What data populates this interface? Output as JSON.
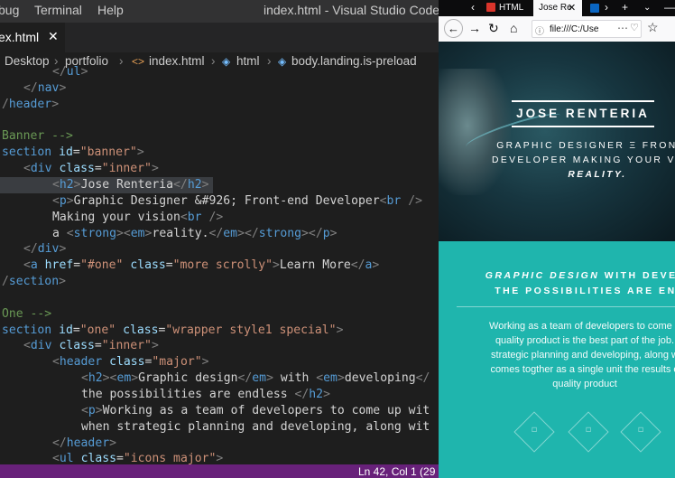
{
  "vscode": {
    "menu": {
      "debug": "bug",
      "terminal": "Terminal",
      "help": "Help",
      "window_title": "index.html - Visual Studio Code"
    },
    "tab": {
      "label": "ex.html",
      "close": "✕"
    },
    "breadcrumb": {
      "items": [
        "Desktop",
        "portfolio",
        "index.html",
        "html",
        "body.landing.is-preload"
      ],
      "separator": "›",
      "icons": [
        "xml-icon",
        "cube-icon",
        "cube-icon"
      ]
    },
    "code_lines": [
      [
        [
          "p",
          "</"
        ],
        [
          "t",
          "ul"
        ],
        [
          "p",
          ">"
        ]
      ],
      [
        [
          "p",
          "</"
        ],
        [
          "t",
          "nav"
        ],
        [
          "p",
          ">"
        ]
      ],
      [
        [
          "p",
          "/"
        ],
        [
          "t",
          "header"
        ],
        [
          "p",
          ">"
        ]
      ],
      [],
      [
        [
          "c",
          "Banner -->"
        ]
      ],
      [
        [
          "t",
          "section"
        ],
        [
          "x",
          " "
        ],
        [
          "a",
          "id"
        ],
        [
          "x",
          "="
        ],
        [
          "s",
          "\"banner\""
        ],
        [
          "p",
          ">"
        ]
      ],
      [
        [
          "p",
          "<"
        ],
        [
          "t",
          "div"
        ],
        [
          "x",
          " "
        ],
        [
          "a",
          "class"
        ],
        [
          "x",
          "="
        ],
        [
          "s",
          "\"inner\""
        ],
        [
          "p",
          ">"
        ]
      ],
      [
        [
          "p",
          "<"
        ],
        [
          "t",
          "h2"
        ],
        [
          "p",
          ">"
        ],
        [
          "x",
          "Jose Renteria"
        ],
        [
          "p",
          "</"
        ],
        [
          "t",
          "h2"
        ],
        [
          "p",
          ">"
        ]
      ],
      [
        [
          "p",
          "<"
        ],
        [
          "t",
          "p"
        ],
        [
          "p",
          ">"
        ],
        [
          "x",
          "Graphic Designer &#926; Front-end Developer"
        ],
        [
          "p",
          "<"
        ],
        [
          "t",
          "br"
        ],
        [
          "x",
          " "
        ],
        [
          "p",
          "/>"
        ]
      ],
      [
        [
          "x",
          "Making your vision"
        ],
        [
          "p",
          "<"
        ],
        [
          "t",
          "br"
        ],
        [
          "x",
          " "
        ],
        [
          "p",
          "/>"
        ]
      ],
      [
        [
          "x",
          "a "
        ],
        [
          "p",
          "<"
        ],
        [
          "t",
          "strong"
        ],
        [
          "p",
          "><"
        ],
        [
          "t",
          "em"
        ],
        [
          "p",
          ">"
        ],
        [
          "x",
          "reality."
        ],
        [
          "p",
          "</"
        ],
        [
          "t",
          "em"
        ],
        [
          "p",
          "></"
        ],
        [
          "t",
          "strong"
        ],
        [
          "p",
          "></"
        ],
        [
          "t",
          "p"
        ],
        [
          "p",
          ">"
        ]
      ],
      [
        [
          "p",
          "</"
        ],
        [
          "t",
          "div"
        ],
        [
          "p",
          ">"
        ]
      ],
      [
        [
          "p",
          "<"
        ],
        [
          "t",
          "a"
        ],
        [
          "x",
          " "
        ],
        [
          "a",
          "href"
        ],
        [
          "x",
          "="
        ],
        [
          "s",
          "\"#one\""
        ],
        [
          "x",
          " "
        ],
        [
          "a",
          "class"
        ],
        [
          "x",
          "="
        ],
        [
          "s",
          "\"more scrolly\""
        ],
        [
          "p",
          ">"
        ],
        [
          "x",
          "Learn More"
        ],
        [
          "p",
          "</"
        ],
        [
          "t",
          "a"
        ],
        [
          "p",
          ">"
        ]
      ],
      [
        [
          "p",
          "/"
        ],
        [
          "t",
          "section"
        ],
        [
          "p",
          ">"
        ]
      ],
      [],
      [
        [
          "c",
          "One -->"
        ]
      ],
      [
        [
          "t",
          "section"
        ],
        [
          "x",
          " "
        ],
        [
          "a",
          "id"
        ],
        [
          "x",
          "="
        ],
        [
          "s",
          "\"one\""
        ],
        [
          "x",
          " "
        ],
        [
          "a",
          "class"
        ],
        [
          "x",
          "="
        ],
        [
          "s",
          "\"wrapper style1 special\""
        ],
        [
          "p",
          ">"
        ]
      ],
      [
        [
          "p",
          "<"
        ],
        [
          "t",
          "div"
        ],
        [
          "x",
          " "
        ],
        [
          "a",
          "class"
        ],
        [
          "x",
          "="
        ],
        [
          "s",
          "\"inner\""
        ],
        [
          "p",
          ">"
        ]
      ],
      [
        [
          "p",
          "<"
        ],
        [
          "t",
          "header"
        ],
        [
          "x",
          " "
        ],
        [
          "a",
          "class"
        ],
        [
          "x",
          "="
        ],
        [
          "s",
          "\"major\""
        ],
        [
          "p",
          ">"
        ]
      ],
      [
        [
          "p",
          "<"
        ],
        [
          "t",
          "h2"
        ],
        [
          "p",
          "><"
        ],
        [
          "t",
          "em"
        ],
        [
          "p",
          ">"
        ],
        [
          "x",
          "Graphic design"
        ],
        [
          "p",
          "</"
        ],
        [
          "t",
          "em"
        ],
        [
          "p",
          ">"
        ],
        [
          "x",
          " with "
        ],
        [
          "p",
          "<"
        ],
        [
          "t",
          "em"
        ],
        [
          "p",
          ">"
        ],
        [
          "x",
          "developing"
        ],
        [
          "p",
          "</"
        ]
      ],
      [
        [
          "x",
          "the possibilities are endless "
        ],
        [
          "p",
          "</"
        ],
        [
          "t",
          "h2"
        ],
        [
          "p",
          ">"
        ]
      ],
      [
        [
          "p",
          "<"
        ],
        [
          "t",
          "p"
        ],
        [
          "p",
          ">"
        ],
        [
          "x",
          "Working as a team of developers to come up wit"
        ]
      ],
      [
        [
          "x",
          "when strategic planning and developing, along wit"
        ]
      ],
      [
        [
          "p",
          "</"
        ],
        [
          "t",
          "header"
        ],
        [
          "p",
          ">"
        ]
      ],
      [
        [
          "p",
          "<"
        ],
        [
          "t",
          "ul"
        ],
        [
          "x",
          " "
        ],
        [
          "a",
          "class"
        ],
        [
          "x",
          "="
        ],
        [
          "s",
          "\"icons major\""
        ],
        [
          "p",
          ">"
        ]
      ]
    ],
    "status": {
      "position": "Ln 42, Col 1 (29"
    }
  },
  "firefox": {
    "tabs": [
      {
        "label": "HTML",
        "favicon": "html-favicon"
      },
      {
        "label": "Jose Re",
        "favicon": ""
      },
      {
        "label": "",
        "favicon": "linkedin-favicon"
      }
    ],
    "url": "file:///C:/Use",
    "site": {
      "title": "JOSE RENTERIA",
      "tagline": [
        "GRAPHIC DESIGNER Ξ FRONT-E",
        "DEVELOPER MAKING YOUR VISIO",
        "REALITY."
      ],
      "major_heading": [
        "GRAPHIC DESIGN",
        " WITH DEVELO",
        "THE POSSIBILITIES ARE END"
      ],
      "body": [
        "Working as a team of developers to come u",
        "quality product is the best part of the job.",
        "strategic planning and developing, along w",
        "comes togther as a single unit the results e",
        "quality product"
      ]
    }
  }
}
